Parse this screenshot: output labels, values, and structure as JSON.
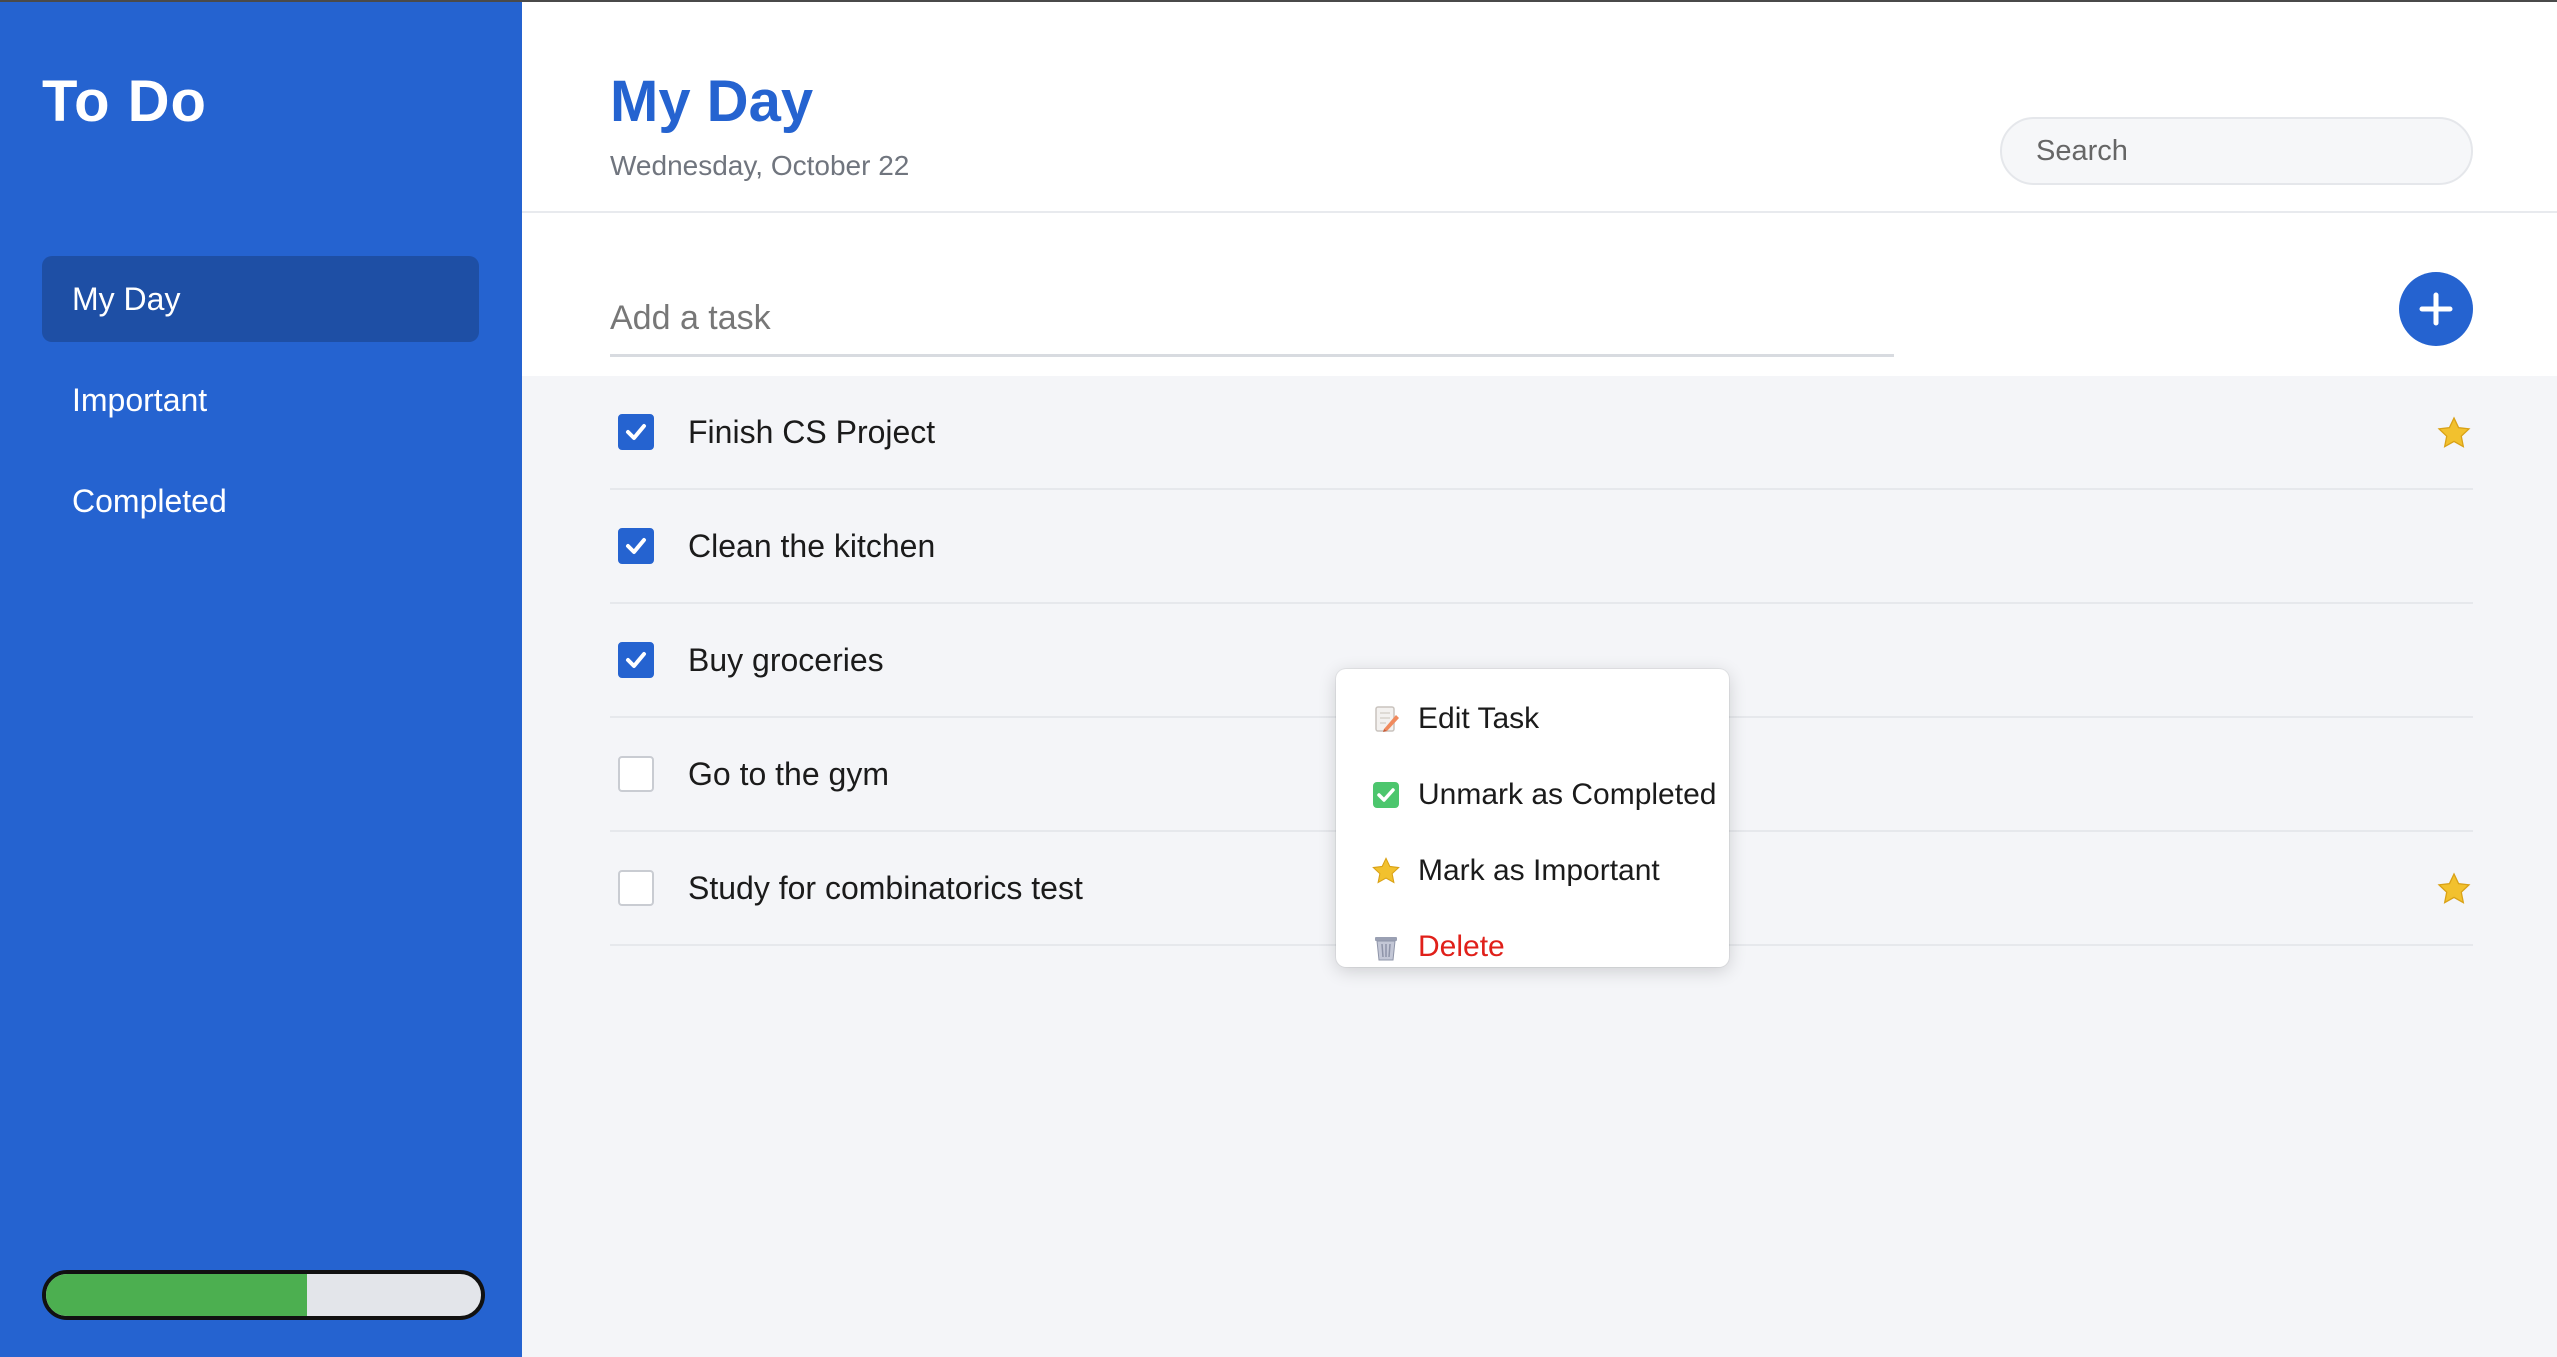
{
  "sidebar": {
    "brand": "To Do",
    "items": [
      {
        "label": "My Day",
        "active": true
      },
      {
        "label": "Important",
        "active": false
      },
      {
        "label": "Completed",
        "active": false
      }
    ],
    "progress": 0.6
  },
  "header": {
    "title": "My Day",
    "date": "Wednesday, October 22",
    "search_placeholder": "Search"
  },
  "add_task": {
    "placeholder": "Add a task",
    "button_icon": "plus-icon"
  },
  "tasks": [
    {
      "label": "Finish CS Project",
      "completed": true,
      "important": true
    },
    {
      "label": "Clean the kitchen",
      "completed": true,
      "important": false
    },
    {
      "label": "Buy groceries",
      "completed": true,
      "important": false
    },
    {
      "label": "Go to the gym",
      "completed": false,
      "important": false
    },
    {
      "label": "Study for combinatorics test",
      "completed": false,
      "important": true
    }
  ],
  "context_menu": {
    "items": [
      {
        "label": "Edit Task",
        "icon": "edit-icon"
      },
      {
        "label": "Unmark as Completed",
        "icon": "check-icon"
      },
      {
        "label": "Mark as Important",
        "icon": "star-icon"
      },
      {
        "label": "Delete",
        "icon": "trash-icon"
      }
    ]
  },
  "colors": {
    "accent": "#2563d0",
    "sidebar_active": "#1e4fa5",
    "progress_fill": "#4caf50",
    "danger": "#e0201a",
    "star": "#f2c12e"
  }
}
